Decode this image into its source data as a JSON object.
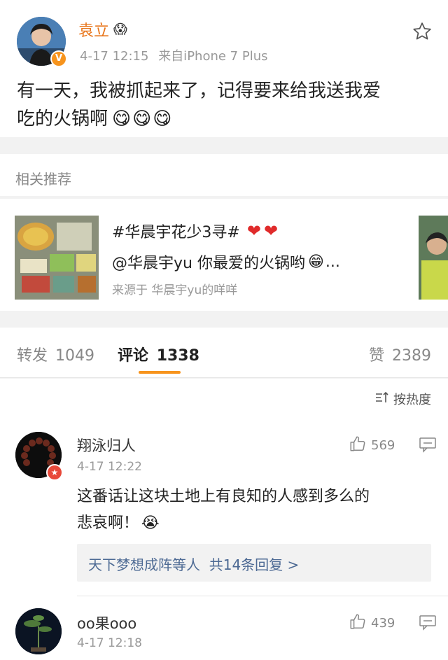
{
  "post": {
    "author": "袁立",
    "author_emoji": "😱",
    "time": "4-17 12:15",
    "source": "来自iPhone 7 Plus",
    "text_line1": "有一天，我被抓起来了，记得要来给我送我爱",
    "text_line2": "吃的火锅啊",
    "emojis": "😋😋😋"
  },
  "recommend": {
    "header": "相关推荐",
    "title": "#华晨宇花少3寻#",
    "title_hearts": "❤❤",
    "desc": "@华晨宇yu 你最爱的火锅哟",
    "desc_emoji": "😁",
    "desc_ellipsis": "...",
    "source": "来源于 华晨宇yu的咩咩"
  },
  "tabs": {
    "repost_label": "转发",
    "repost_count": "1049",
    "comment_label": "评论",
    "comment_count": "1338",
    "like_label": "赞",
    "like_count": "2389",
    "active_color": "#f7941d"
  },
  "sort": {
    "label": "按热度"
  },
  "comments": [
    {
      "user": "翔泳归人",
      "time": "4-17 12:22",
      "likes": "569",
      "text_line1": "这番话让这块土地上有良知的人感到多么的",
      "text_line2": "悲哀啊！",
      "emoji": "😭",
      "reply_text": "天下梦想成阵等人  共14条回复 >"
    },
    {
      "user": "oo果ooo",
      "time": "4-17 12:18",
      "likes": "439"
    }
  ]
}
